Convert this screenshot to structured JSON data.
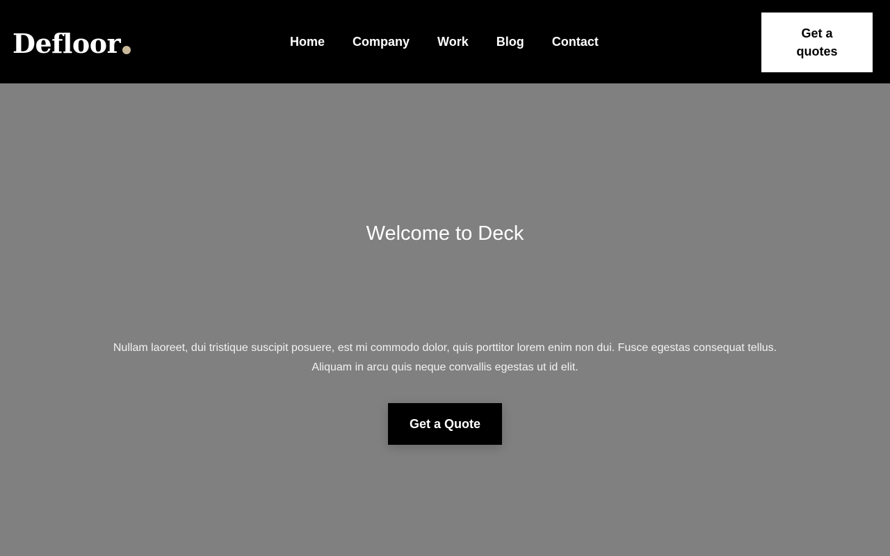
{
  "header": {
    "logo": {
      "text": "Defloor",
      "dot_color": "#c9b99a"
    },
    "nav": [
      {
        "label": "Home"
      },
      {
        "label": "Company"
      },
      {
        "label": "Work"
      },
      {
        "label": "Blog"
      },
      {
        "label": "Contact"
      }
    ],
    "cta_label": "Get a quotes"
  },
  "hero": {
    "title": "Welcome to Deck",
    "text": "Nullam laoreet, dui tristique suscipit posuere, est mi commodo dolor, quis porttitor lorem enim non dui. Fusce egestas consequat tellus. Aliquam in arcu quis neque convallis egestas ut id elit.",
    "button_label": "Get a Quote"
  },
  "colors": {
    "header_bg": "#000000",
    "hero_bg": "#808080",
    "accent": "#c9b99a"
  }
}
